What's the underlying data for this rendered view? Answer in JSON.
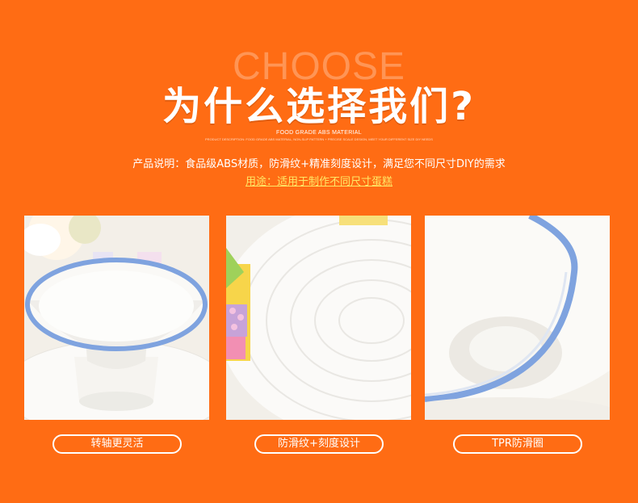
{
  "header": {
    "bg_word": "CHOOSE",
    "title": "为什么选择我们?",
    "subtitle_en": "FOOD GRADE ABS MATERIAL",
    "subtitle_small": "PRODUCT DESCRIPTION: FOOD GRADE ABS MATERIAL, NON-SLIP PATTERN + PRECISE SCALE DESIGN, MEET YOUR DIFFERENT SIZE DIY NEEDS"
  },
  "description": "产品说明：食品级ABS材质，防滑纹+精准刻度设计，满足您不同尺寸DIY的需求",
  "usage": "用途：适用于制作不同尺寸蛋糕",
  "features": [
    {
      "label": "转轴更灵活"
    },
    {
      "label": "防滑纹+刻度设计"
    },
    {
      "label": "TPR防滑圈"
    }
  ],
  "colors": {
    "background": "#ff6c14",
    "accent_text": "#ffe866",
    "rim_blue": "#7fa3df"
  }
}
